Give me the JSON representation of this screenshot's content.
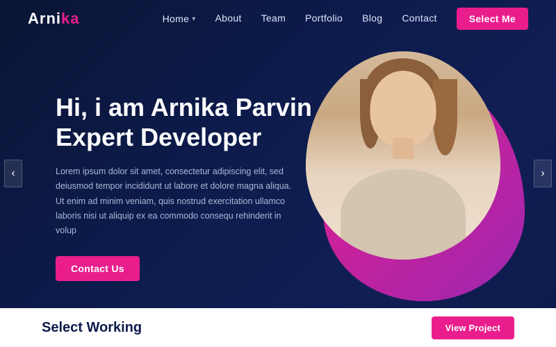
{
  "logo": {
    "part1": "Arni",
    "part2": "ka"
  },
  "nav": {
    "home_label": "Home",
    "about_label": "About",
    "team_label": "Team",
    "portfolio_label": "Portfolio",
    "blog_label": "Blog",
    "contact_label": "Contact",
    "select_me_label": "Select Me"
  },
  "hero": {
    "greeting": "Hi, i am Arnika Parvin",
    "tagline": "Expert Developer",
    "description": "Lorem ipsum dolor sit amet, consectetur adipiscing elit, sed deiusmod tempor incididunt ut labore et dolore magna aliqua. Ut enim ad minim veniam, quis nostrud exercitation ullamco laboris nisi ut aliquip ex ea commodo consequ rehinderit in volup",
    "contact_btn": "Contact Us"
  },
  "bottom": {
    "title": "Select Working",
    "view_btn": "View Project"
  },
  "arrows": {
    "left": "‹",
    "right": "›"
  }
}
